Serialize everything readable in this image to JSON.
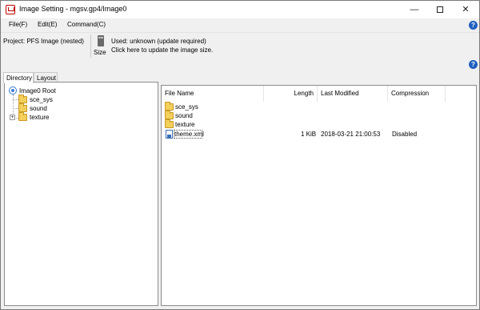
{
  "window": {
    "title": "Image Setting - mgsv.gp4/Image0",
    "minimize_glyph": "—",
    "close_glyph": "✕"
  },
  "menu": {
    "items": [
      "File(F)",
      "Edit(E)",
      "Command(C)"
    ],
    "help_glyph": "?"
  },
  "toolbar": {
    "project_label": "Project: PFS Image (nested)",
    "size_label": "Size",
    "used_text": "Used: unknown (update required)",
    "update_link": "Click here to update the image size.",
    "help_glyph": "?"
  },
  "tabs": [
    "Directory",
    "Layout"
  ],
  "tree": {
    "root": "Image0 Root",
    "children": [
      "sce_sys",
      "sound",
      "texture"
    ],
    "expander_glyph": "+"
  },
  "file_list": {
    "columns": [
      "File Name",
      "Length",
      "Last Modified",
      "Compression"
    ],
    "rows": [
      {
        "name": "sce_sys",
        "length": "",
        "modified": "",
        "compression": "",
        "type": "folder"
      },
      {
        "name": "sound",
        "length": "",
        "modified": "",
        "compression": "",
        "type": "folder"
      },
      {
        "name": "texture",
        "length": "",
        "modified": "",
        "compression": "",
        "type": "folder"
      },
      {
        "name": "theme.xml",
        "length": "1 KiB",
        "modified": "2018-03-21 21:00:53",
        "compression": "Disabled",
        "type": "file"
      }
    ]
  },
  "colors": {
    "help_icon": "#1f5fbf",
    "folder": "#f4cf5c",
    "app_icon": "#c00000"
  }
}
